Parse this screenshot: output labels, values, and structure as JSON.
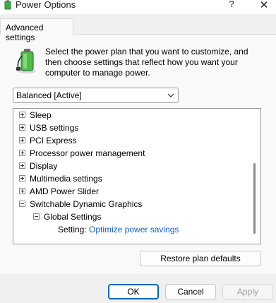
{
  "window": {
    "title": "Power Options",
    "help_label": "?",
    "close_label": "✕"
  },
  "tab": {
    "label": "Advanced settings"
  },
  "intro": {
    "text": "Select the power plan that you want to customize, and then choose settings that reflect how you want your computer to manage power."
  },
  "plan_select": {
    "value": "Balanced [Active]"
  },
  "tree": {
    "items": [
      {
        "label": "Sleep",
        "state": "collapsed"
      },
      {
        "label": "USB settings",
        "state": "collapsed"
      },
      {
        "label": "PCI Express",
        "state": "collapsed"
      },
      {
        "label": "Processor power management",
        "state": "collapsed"
      },
      {
        "label": "Display",
        "state": "collapsed"
      },
      {
        "label": "Multimedia settings",
        "state": "collapsed"
      },
      {
        "label": "AMD Power Slider",
        "state": "collapsed"
      },
      {
        "label": "Switchable Dynamic Graphics",
        "state": "expanded"
      }
    ],
    "subitem": {
      "label": "Global Settings",
      "state": "expanded"
    },
    "setting": {
      "label": "Setting:",
      "value": "Optimize power savings"
    }
  },
  "buttons": {
    "restore": "Restore plan defaults",
    "ok": "OK",
    "cancel": "Cancel",
    "apply": "Apply"
  },
  "colors": {
    "link": "#0b61c5",
    "accent": "#0067c0",
    "battery_green": "#3cb043"
  }
}
